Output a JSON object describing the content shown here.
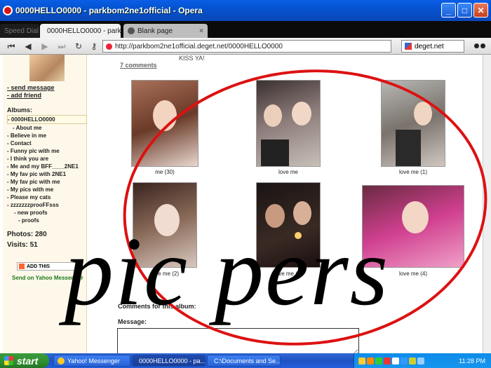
{
  "window": {
    "title": "0000HELLO0000 - parkbom2ne1official - Opera",
    "minimize": "_",
    "maximize": "□",
    "close": "✕"
  },
  "tabs": [
    {
      "label": "0000HELLO0000 - parkb...",
      "active": true,
      "close": "×"
    },
    {
      "label": "Blank page",
      "active": false,
      "close": "×"
    }
  ],
  "ghost_tab": "Speed Dial",
  "new_tab": "+",
  "address": {
    "url": "http://parkbom2ne1official.deget.net/0000HELLO0000",
    "search_engine": "deget.net"
  },
  "toolbar_icons": [
    "rewind-icon",
    "back-icon",
    "forward-icon",
    "fast-forward-icon",
    "reload-icon",
    "key-icon"
  ],
  "sidebar": {
    "links": [
      "send message",
      "add friend"
    ],
    "albums_heading": "Albums:",
    "albums": [
      "- 0000HELLO0000",
      "- About me",
      "- Believe in me",
      "- Contact",
      "- Funny pic with me",
      "- I think you are",
      "- Me and my BFF____2NE1",
      "- My fav pic with 2NE1",
      "- My fav pic with me",
      "- My pics with me",
      "- Please my cats",
      "- zzzzzzzprooFFsss",
      "- new proofs",
      "- proofs"
    ],
    "photos": "Photos: 280",
    "visits": "Visits: 51",
    "addthis": "ADD THIS",
    "send_yahoo": "Send on Yahoo Messenger"
  },
  "main": {
    "kiss": "KISS YA!",
    "comments_link": "7 comments",
    "photos": [
      {
        "caption": "me (30)"
      },
      {
        "caption": "love me"
      },
      {
        "caption": "love me (1)"
      },
      {
        "caption": "love me (2)"
      },
      {
        "caption": "love me (3)"
      },
      {
        "caption": "love me (4)"
      }
    ],
    "comments_heading": "Comments for this album:",
    "message_label": "Message:"
  },
  "overlay": {
    "text": "pic pers",
    "ellipse_color": "#dd1111"
  },
  "taskbar": {
    "start": "start",
    "tasks": [
      {
        "label": "Yahoo! Messenger",
        "icon": "yahoo-icon"
      },
      {
        "label": "0000HELLO0000 - pa...",
        "icon": "opera-icon"
      },
      {
        "label": "C:\\Documents and Se...",
        "icon": "folder-icon"
      }
    ],
    "clock": "11:28 PM"
  }
}
